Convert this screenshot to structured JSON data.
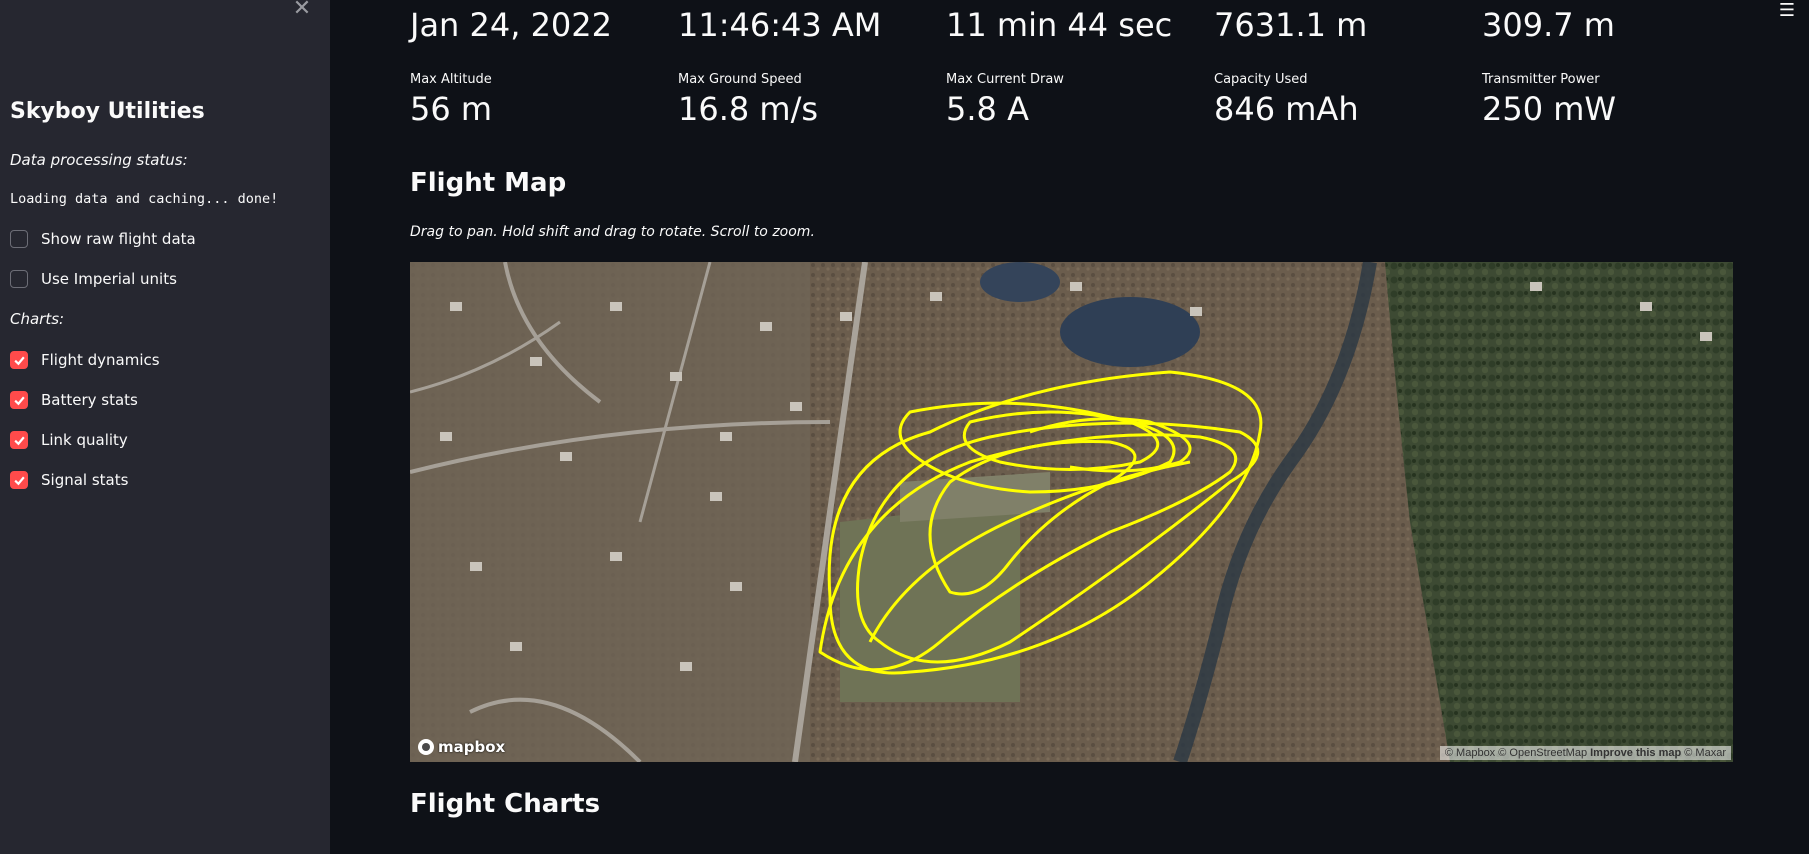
{
  "sidebar": {
    "close_icon": "close-icon",
    "title": "Skyboy Utilities",
    "status_label": "Data processing status:",
    "status_text": "Loading data and caching... done!",
    "options": [
      {
        "label": "Show raw flight data",
        "checked": false
      },
      {
        "label": "Use Imperial units",
        "checked": false
      }
    ],
    "charts_label": "Charts:",
    "charts": [
      {
        "label": "Flight dynamics",
        "checked": true
      },
      {
        "label": "Battery stats",
        "checked": true
      },
      {
        "label": "Link quality",
        "checked": true
      },
      {
        "label": "Signal stats",
        "checked": true
      }
    ]
  },
  "menu_icon": "hamburger-menu-icon",
  "metrics_top": [
    {
      "value": "Jan 24, 2022"
    },
    {
      "value": "11:46:43 AM"
    },
    {
      "value": "11 min 44 sec"
    },
    {
      "value": "7631.1 m"
    },
    {
      "value": "309.7 m"
    }
  ],
  "metrics_bottom": [
    {
      "label": "Max Altitude",
      "value": "56 m"
    },
    {
      "label": "Max Ground Speed",
      "value": "16.8 m/s"
    },
    {
      "label": "Max Current Draw",
      "value": "5.8 A"
    },
    {
      "label": "Capacity Used",
      "value": "846 mAh"
    },
    {
      "label": "Transmitter Power",
      "value": "250 mW"
    }
  ],
  "flight_map": {
    "heading": "Flight Map",
    "caption": "Drag to pan. Hold shift and drag to rotate. Scroll to zoom.",
    "logo_text": "mapbox",
    "attribution": "© Mapbox © OpenStreetMap",
    "improve_link": "Improve this map",
    "attribution_suffix": "© Maxar",
    "track_color": "#ffff00"
  },
  "flight_charts": {
    "heading": "Flight Charts"
  },
  "colors": {
    "background": "#0e1117",
    "sidebar": "#262730",
    "accent": "#ff4b4b"
  }
}
